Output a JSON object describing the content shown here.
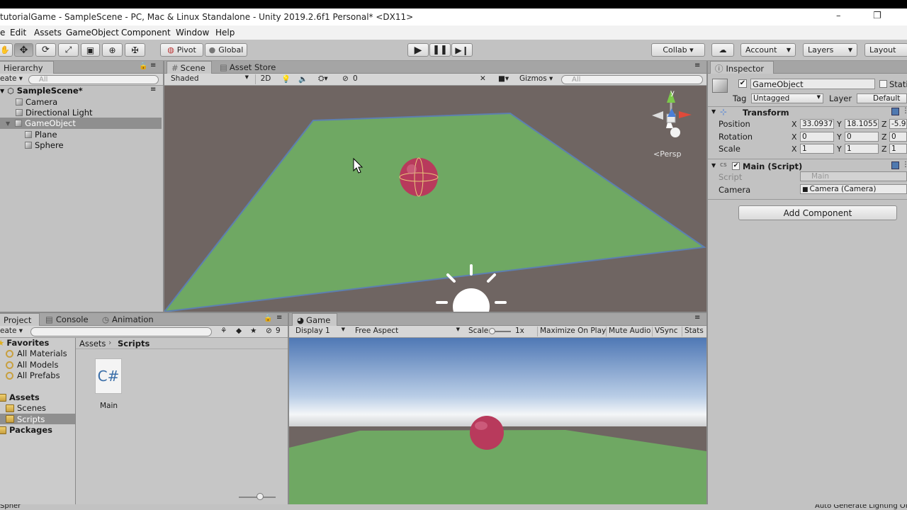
{
  "window": {
    "title": "tutorialGame - SampleScene - PC, Mac & Linux Standalone - Unity 2019.2.6f1 Personal* <DX11>",
    "minimize": "–",
    "maximize": "❐",
    "close": "✕"
  },
  "menu": [
    "e",
    "Edit",
    "Assets",
    "GameObject",
    "Component",
    "Window",
    "Help"
  ],
  "toolbar": {
    "pivot": "Pivot",
    "global": "Global",
    "collab": "Collab ▾",
    "account": "Account",
    "layers": "Layers",
    "layout": "Layout"
  },
  "hierarchy": {
    "tab": "Hierarchy",
    "create": "eate ▾",
    "search_placeholder": "All",
    "scene": "SampleScene*",
    "items": [
      "Camera",
      "Directional Light",
      "GameObject",
      "Plane",
      "Sphere"
    ]
  },
  "scene": {
    "tabs": [
      "Scene",
      "Asset Store"
    ],
    "shading": "Shaded",
    "mode_2d": "2D",
    "fx_count": "0",
    "gizmos": "Gizmos",
    "search_placeholder": "All",
    "persp": "<Persp",
    "axis_y": "y"
  },
  "project": {
    "tabs": [
      "Project",
      "Console",
      "Animation"
    ],
    "create": "eate ▾",
    "hidden_count": "9",
    "favorites": "Favorites",
    "fav_items": [
      "All Materials",
      "All Models",
      "All Prefabs"
    ],
    "assets": "Assets",
    "asset_items": [
      "Scenes",
      "Scripts"
    ],
    "packages": "Packages",
    "breadcrumb": [
      "Assets",
      "Scripts"
    ],
    "file_icon": "C#",
    "file_name": "Main"
  },
  "game": {
    "tab": "Game",
    "display": "Display 1",
    "aspect": "Free Aspect",
    "scale_label": "Scale",
    "scale_value": "1x",
    "toggles": [
      "Maximize On Play",
      "Mute Audio",
      "VSync",
      "Stats"
    ]
  },
  "inspector": {
    "tab": "Inspector",
    "object_name": "GameObject",
    "static": "Stati",
    "tag_label": "Tag",
    "tag_value": "Untagged",
    "layer_label": "Layer",
    "layer_value": "Default",
    "transform_title": "Transform",
    "rows": [
      {
        "label": "Position",
        "x": "33.0937",
        "y": "18.1055",
        "z": "-5.9"
      },
      {
        "label": "Rotation",
        "x": "0",
        "y": "0",
        "z": "0"
      },
      {
        "label": "Scale",
        "x": "1",
        "y": "1",
        "z": "1"
      }
    ],
    "axis_x": "X",
    "axis_y": "Y",
    "axis_z": "Z",
    "script_component": "Main (Script)",
    "script_label": "Script",
    "script_value": "Main",
    "camera_label": "Camera",
    "camera_value": "Camera (Camera)",
    "add_component": "Add Component"
  },
  "status": {
    "left": "Spher",
    "right": "Auto Generate Lighting Off"
  },
  "colors": {
    "panel": "#c2c2c2",
    "plane": "#6fa863",
    "sphere": "#b83a5c",
    "scene_bg": "#6f6562"
  }
}
